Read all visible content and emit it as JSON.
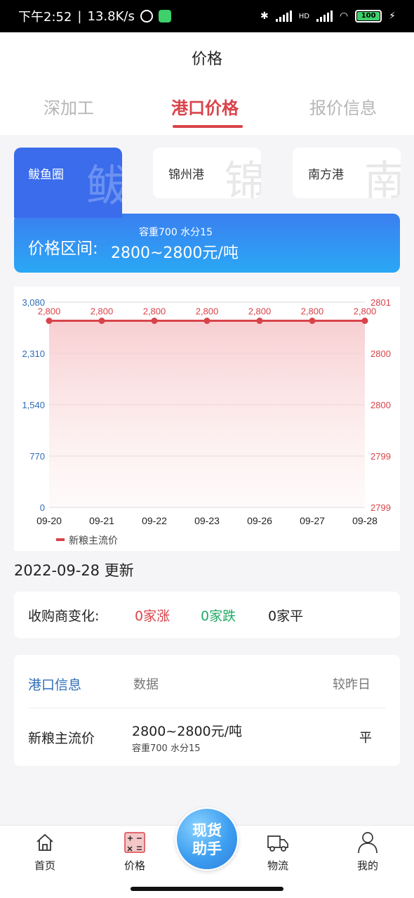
{
  "status_bar": {
    "time": "下午2:52",
    "speed": "13.8K/s",
    "net": "HD",
    "battery": "100"
  },
  "header": {
    "title": "价格",
    "tabs": [
      {
        "label": "深加工",
        "active": false
      },
      {
        "label": "港口价格",
        "active": true
      },
      {
        "label": "报价信息",
        "active": false
      }
    ]
  },
  "ports": {
    "items": [
      {
        "label": "鲅鱼圈",
        "bg_char": "鲅",
        "active": true
      },
      {
        "label": "锦州港",
        "bg_char": "锦",
        "active": false
      },
      {
        "label": "南方港",
        "bg_char": "南",
        "active": false
      }
    ],
    "price_label": "价格区间:",
    "price_sub": "容重700 水分15",
    "price_range": "2800~2800元/吨"
  },
  "chart_data": {
    "type": "line",
    "categories": [
      "09-20",
      "09-21",
      "09-22",
      "09-23",
      "09-26",
      "09-27",
      "09-28"
    ],
    "series": [
      {
        "name": "新粮主流价",
        "values": [
          2800,
          2800,
          2800,
          2800,
          2800,
          2800,
          2800
        ],
        "color": "#d9434a"
      }
    ],
    "data_labels": [
      "2,800",
      "2,800",
      "2,800",
      "2,800",
      "2,800",
      "2,800",
      "2,800"
    ],
    "left_ticks": [
      "3,080",
      "2,310",
      "1,540",
      "770",
      "0"
    ],
    "right_ticks": [
      "2801",
      "2800",
      "2800",
      "2799",
      "2799"
    ],
    "ylim": [
      0,
      3080
    ],
    "left_axis_color": "#2f6db5",
    "right_axis_color": "#d9434a",
    "grid": true,
    "legend": "bottom-left"
  },
  "updated": "2022-09-28 更新",
  "buyer_change": {
    "label": "收购商变化:",
    "up": "0家涨",
    "down": "0家跌",
    "flat": "0家平"
  },
  "port_info": {
    "headers": [
      "港口信息",
      "数据",
      "较昨日"
    ],
    "row": {
      "name": "新粮主流价",
      "price": "2800~2800元/吨",
      "spec": "容重700   水分15",
      "change": "平"
    }
  },
  "bottom_nav": {
    "items": [
      {
        "label": "首页",
        "icon": "home-icon"
      },
      {
        "label": "价格",
        "icon": "calculator-icon"
      },
      {
        "label": "物流",
        "icon": "truck-icon"
      },
      {
        "label": "我的",
        "icon": "user-icon"
      }
    ],
    "fab_line1": "现货",
    "fab_line2": "助手"
  }
}
